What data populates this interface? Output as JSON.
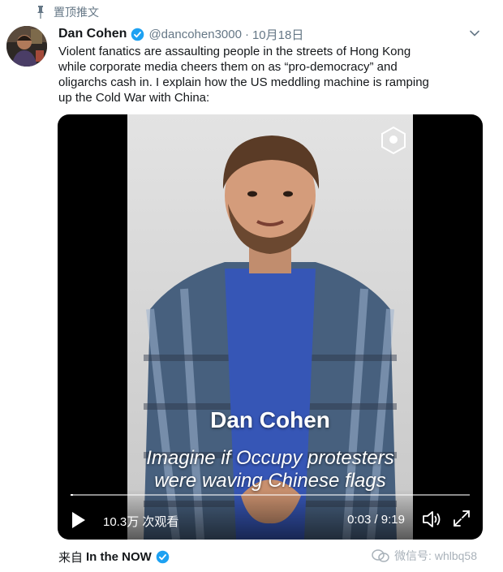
{
  "pinned": {
    "icon": "pin-icon",
    "label": "置顶推文"
  },
  "author": {
    "name": "Dan Cohen",
    "handle": "@dancohen3000",
    "separator": "·",
    "date": "10月18日",
    "verified_color": "#1da1f2"
  },
  "tweet": {
    "lines": [
      "Violent fanatics are assaulting people in the streets of Hong Kong",
      "while corporate media cheers them on as “pro-democracy” and",
      "oligarchs cash in. I explain how the US meddling machine is ramping",
      "up the Cold War with China:"
    ]
  },
  "video": {
    "caption_name": "Dan Cohen",
    "caption_line1": "Imagine if Occupy protesters",
    "caption_line2": "were waving Chinese flags",
    "views": "10.3万 次观看",
    "time": "0:03 / 9:19",
    "progress": 0.006
  },
  "source": {
    "prefix": "来自",
    "app": "In the NOW"
  },
  "watermark": "微信号: whlbq58"
}
